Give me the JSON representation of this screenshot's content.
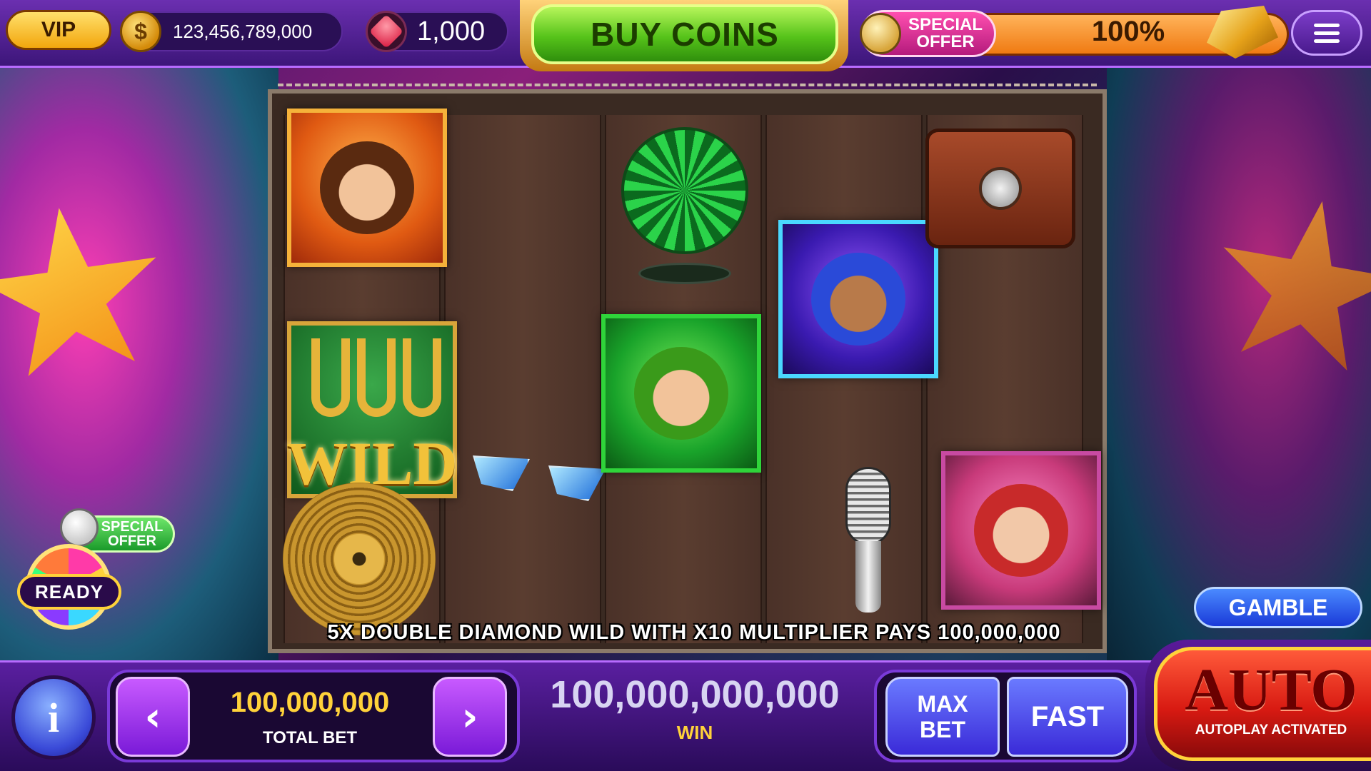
{
  "topbar": {
    "vip_label": "VIP",
    "coin_symbol": "$",
    "coin_balance": "123,456,789,000",
    "gem_balance": "1,000",
    "buy_coins_label": "BUY COINS",
    "special_offer_line1": "SPECIAL",
    "special_offer_line2": "OFFER",
    "offer_progress_text": "100%",
    "offer_progress": 1.0
  },
  "reels": {
    "wild_label": "WILD",
    "symbols": [
      {
        "reel": 1,
        "row": 1,
        "name": "disco-man-symbol"
      },
      {
        "reel": 1,
        "row": 2,
        "name": "horseshoe-wild-symbol"
      },
      {
        "reel": 1,
        "row": 3,
        "name": "gold-record-symbol"
      },
      {
        "reel": 2,
        "row": 3,
        "name": "sunglasses-symbol"
      },
      {
        "reel": 3,
        "row": 1,
        "name": "disco-ball-symbol"
      },
      {
        "reel": 3,
        "row": 2,
        "name": "green-hair-girl-symbol"
      },
      {
        "reel": 4,
        "row": 2,
        "name": "dj-headphones-symbol"
      },
      {
        "reel": 4,
        "row": 3,
        "name": "microphone-symbol"
      },
      {
        "reel": 5,
        "row": 1,
        "name": "retro-radio-symbol"
      },
      {
        "reel": 5,
        "row": 3,
        "name": "red-hair-girl-symbol"
      }
    ],
    "win_line_text": "5X DOUBLE DIAMOND WILD WITH X10 MULTIPLIER PAYS 100,000,000"
  },
  "side": {
    "special_offer_line1": "SPECIAL",
    "special_offer_line2": "OFFER",
    "ready_label": "READY",
    "gamble_label": "GAMBLE"
  },
  "bottombar": {
    "info_label": "i",
    "prev_label": "‹",
    "next_label": "›",
    "total_bet_value": "100,000,000",
    "total_bet_label": "TOTAL BET",
    "win_value": "100,000,000,000",
    "win_label": "WIN",
    "max_bet_line1": "MAX",
    "max_bet_line2": "BET",
    "fast_label": "FAST",
    "auto_label": "AUTO",
    "auto_sub_label": "AUTOPLAY ACTIVATED"
  },
  "colors": {
    "accent_purple": "#6b2fb0",
    "coin_gold": "#ffd23a",
    "buy_green": "#56c31a",
    "auto_red": "#d81a12"
  }
}
